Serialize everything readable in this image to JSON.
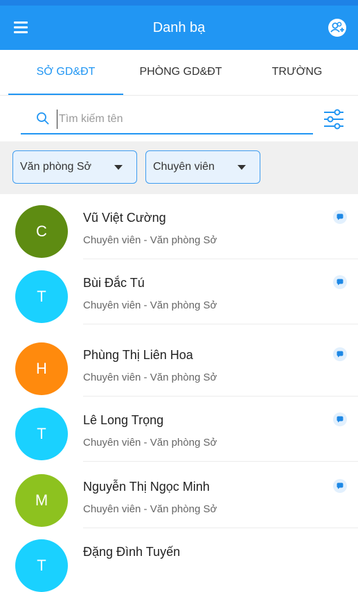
{
  "header": {
    "title": "Danh bạ",
    "menu_icon": "menu-icon",
    "contacts_icon": "contacts-add-icon"
  },
  "tabs": [
    {
      "label": "SỞ GD&ĐT",
      "active": true
    },
    {
      "label": "PHÒNG GD&ĐT",
      "active": false
    },
    {
      "label": "TRƯỜNG",
      "active": false
    }
  ],
  "search": {
    "placeholder": "Tìm kiếm tên",
    "value": ""
  },
  "filters": {
    "office": "Văn phòng Sở",
    "position": "Chuyên viên"
  },
  "contacts": [
    {
      "initial": "C",
      "name": "Vũ Việt Cường",
      "subtitle": "Chuyên viên - Văn phòng Sở",
      "color": "#5e8c12"
    },
    {
      "initial": "T",
      "name": "Bùi Đắc Tú",
      "subtitle": "Chuyên viên - Văn phòng Sở",
      "color": "#1ad1ff"
    },
    {
      "initial": "H",
      "name": "Phùng Thị Liên Hoa",
      "subtitle": "Chuyên viên - Văn phòng Sở",
      "color": "#ff8a0d"
    },
    {
      "initial": "T",
      "name": "Lê Long Trọng",
      "subtitle": "Chuyên viên - Văn phòng Sở",
      "color": "#1ad1ff"
    },
    {
      "initial": "M",
      "name": "Nguyễn Thị Ngọc Minh",
      "subtitle": "Chuyên viên - Văn phòng Sở",
      "color": "#8dc21f"
    },
    {
      "initial": "T",
      "name": "Đặng Đình Tuyến",
      "subtitle": "",
      "color": "#1ad1ff"
    }
  ],
  "colors": {
    "primary": "#2196f3",
    "filter_bg": "#f0f0f0"
  }
}
